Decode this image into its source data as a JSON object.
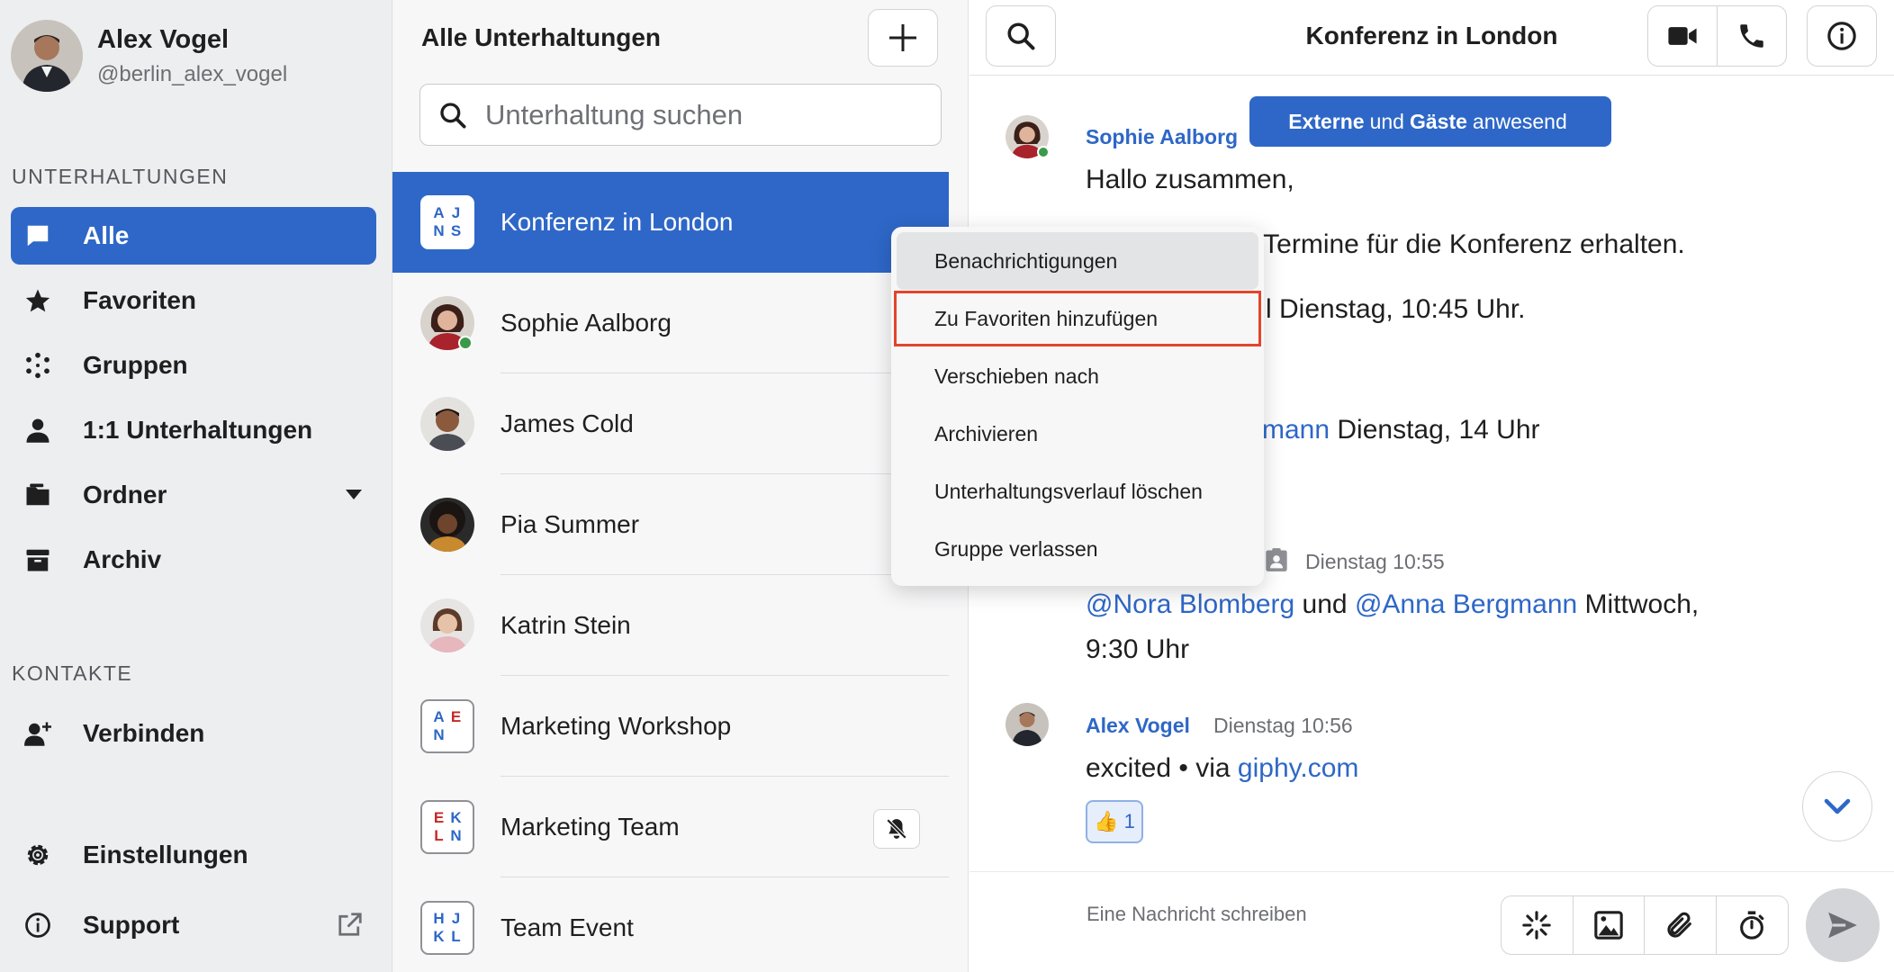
{
  "profile": {
    "name": "Alex Vogel",
    "handle": "@berlin_alex_vogel"
  },
  "sidebar": {
    "section_conversations": "UNTERHALTUNGEN",
    "section_contacts": "KONTAKTE",
    "items": [
      {
        "label": "Alle",
        "icon": "chat-bubble-icon"
      },
      {
        "label": "Favoriten",
        "icon": "star-icon"
      },
      {
        "label": "Gruppen",
        "icon": "dots-group-icon"
      },
      {
        "label": "1:1 Unterhaltungen",
        "icon": "person-icon"
      },
      {
        "label": "Ordner",
        "icon": "folder-icon"
      },
      {
        "label": "Archiv",
        "icon": "archive-icon"
      }
    ],
    "connect": "Verbinden",
    "settings": "Einstellungen",
    "support": "Support"
  },
  "convlist": {
    "title": "Alle Unterhaltungen",
    "search_placeholder": "Unterhaltung suchen",
    "rows": [
      {
        "name": "Konferenz in London",
        "initials": [
          "A",
          "J",
          "N",
          "S"
        ]
      },
      {
        "name": "Sophie Aalborg"
      },
      {
        "name": "James Cold"
      },
      {
        "name": "Pia Summer"
      },
      {
        "name": "Katrin Stein"
      },
      {
        "name": "Marketing Workshop",
        "initials": [
          "A",
          "E",
          "N",
          ""
        ]
      },
      {
        "name": "Marketing Team",
        "initials": [
          "E",
          "K",
          "L",
          "N"
        ]
      },
      {
        "name": "Team Event",
        "initials": [
          "H",
          "J",
          "K",
          "L"
        ]
      }
    ]
  },
  "chat": {
    "title": "Konferenz in London",
    "banner": {
      "part1": "Externe",
      "part2": "und",
      "part3": "Gäste",
      "part4": "anwesend"
    },
    "msg1": {
      "sender": "Sophie Aalborg",
      "line1": "Hallo zusammen,",
      "line2": "ere Termine für die Konferenz erhalten.",
      "line3": "l Dienstag, 10:45 Uhr.",
      "line4_mention": "mann",
      "line4_rest": " Dienstag, 14 Uhr"
    },
    "msg2": {
      "time": "Dienstag 10:55",
      "mention1": "@Nora Blomberg",
      "and": " und ",
      "mention2": "@Anna Bergmann",
      "rest": " Mittwoch,",
      "line2": "9:30 Uhr"
    },
    "msg3": {
      "sender": "Alex Vogel",
      "time": "Dienstag 10:56",
      "text": "excited • via ",
      "link": "giphy.com",
      "reaction_emoji": "👍",
      "reaction_count": "1"
    },
    "composer_placeholder": "Eine Nachricht schreiben"
  },
  "context_menu": {
    "items": [
      "Benachrichtigungen",
      "Zu Favoriten hinzufügen",
      "Verschieben nach",
      "Archivieren",
      "Unterhaltungsverlauf löschen",
      "Gruppe verlassen"
    ]
  },
  "colors": {
    "accent": "#2e67c7",
    "highlight": "#e2452a",
    "online": "#3a9a4a"
  }
}
